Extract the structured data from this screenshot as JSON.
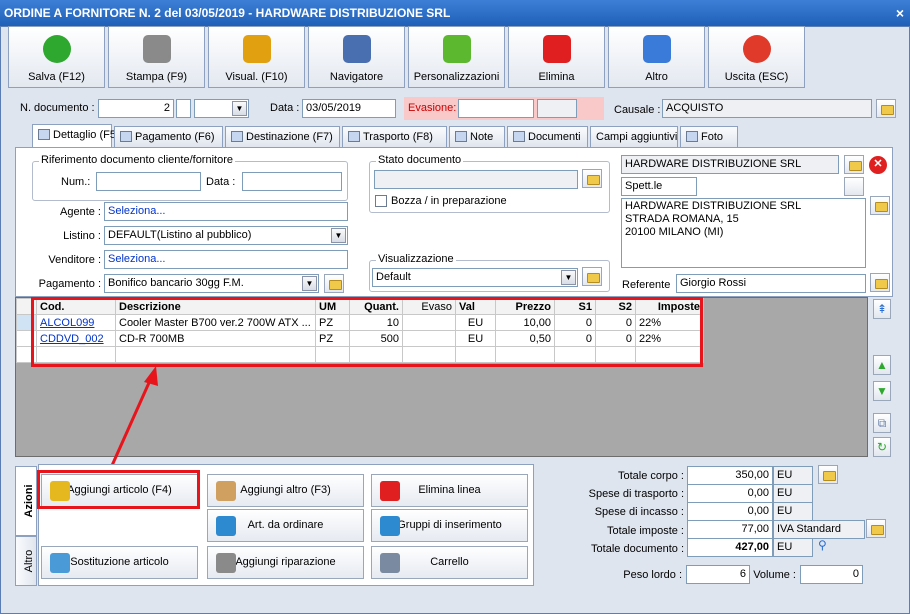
{
  "window": {
    "title": "ORDINE A FORNITORE N. 2 del 03/05/2019 - HARDWARE DISTRIBUZIONE SRL",
    "close": "×"
  },
  "toolbar": [
    {
      "label": "Salva (F12)",
      "icon": "check-icon",
      "color": "#2ea82e"
    },
    {
      "label": "Stampa (F9)",
      "icon": "printer-icon",
      "color": "#8a8a8a"
    },
    {
      "label": "Visual. (F10)",
      "icon": "magic-wand-icon",
      "color": "#e0a010"
    },
    {
      "label": "Navigatore",
      "icon": "compass-icon",
      "color": "#4a6fb0"
    },
    {
      "label": "Personalizzazioni",
      "icon": "puzzle-icon",
      "color": "#5cb82e"
    },
    {
      "label": "Elimina",
      "icon": "delete-x-icon",
      "color": "#e02020"
    },
    {
      "label": "Altro",
      "icon": "magnifier-icon",
      "color": "#3a7ad8"
    },
    {
      "label": "Uscita (ESC)",
      "icon": "power-icon",
      "color": "#e03a2a"
    }
  ],
  "header": {
    "ndoc_label": "N. documento :",
    "ndoc_value": "2",
    "data_label": "Data :",
    "data_value": "03/05/2019",
    "evasione_label": "Evasione:",
    "causale_label": "Causale :",
    "causale_value": "ACQUISTO"
  },
  "tabs": [
    {
      "label": "Dettaglio (F5)",
      "active": true
    },
    {
      "label": "Pagamento (F6)"
    },
    {
      "label": "Destinazione (F7)"
    },
    {
      "label": "Trasporto (F8)"
    },
    {
      "label": "Note"
    },
    {
      "label": "Documenti"
    },
    {
      "label": "Campi aggiuntivi"
    },
    {
      "label": "Foto"
    }
  ],
  "dettaglio": {
    "rif_title": "Riferimento documento cliente/fornitore",
    "num_label": "Num.:",
    "data_label": "Data :",
    "agente_label": "Agente :",
    "agente_value": "Seleziona...",
    "listino_label": "Listino :",
    "listino_value": "DEFAULT(Listino al pubblico)",
    "venditore_label": "Venditore :",
    "venditore_value": "Seleziona...",
    "pagamento_label": "Pagamento :",
    "pagamento_value": "Bonifico bancario 30gg F.M.",
    "stato_title": "Stato documento",
    "bozza_label": "Bozza / in preparazione",
    "visual_title": "Visualizzazione",
    "visual_value": "Default",
    "fornitore_name": "HARDWARE DISTRIBUZIONE SRL",
    "spett": "Spett.le",
    "address_lines": [
      "HARDWARE DISTRIBUZIONE SRL",
      "STRADA ROMANA, 15",
      "20100 MILANO (MI)"
    ],
    "referente_label": "Referente",
    "referente_value": "Giorgio Rossi"
  },
  "grid": {
    "columns": [
      "Cod.",
      "Descrizione",
      "UM",
      "Quant.",
      "Evaso",
      "Val",
      "Prezzo",
      "S1",
      "S2",
      "Imposte"
    ],
    "rows": [
      {
        "cod": "ALCOL099",
        "descr": "Cooler Master B700 ver.2 700W ATX ...",
        "um": "PZ",
        "quant": "10",
        "evaso": "",
        "val": "EU",
        "prezzo": "10,00",
        "s1": "0",
        "s2": "0",
        "imposte": "22%"
      },
      {
        "cod": "CDDVD_002",
        "descr": "CD-R 700MB",
        "um": "PZ",
        "quant": "500",
        "evaso": "",
        "val": "EU",
        "prezzo": "0,50",
        "s1": "0",
        "s2": "0",
        "imposte": "22%"
      }
    ]
  },
  "side_tabs": [
    "Azioni",
    "Altro"
  ],
  "actions": [
    {
      "label": "Aggiungi articolo (F4)",
      "icon": "add-article-icon"
    },
    {
      "label": "Aggiungi altro (F3)",
      "icon": "add-other-icon"
    },
    {
      "label": "Elimina linea",
      "icon": "delete-line-icon"
    },
    {
      "label": "Art. da ordinare",
      "icon": "order-article-icon"
    },
    {
      "label": "Gruppi di inserimento",
      "icon": "insert-group-icon"
    },
    {
      "label": "Sostituzione articolo",
      "icon": "replace-article-icon"
    },
    {
      "label": "Aggiungi riparazione",
      "icon": "repair-icon"
    },
    {
      "label": "Carrello",
      "icon": "cart-icon"
    }
  ],
  "totals": {
    "corpo_label": "Totale corpo :",
    "corpo_value": "350,00",
    "corpo_cur": "EU",
    "trasporto_label": "Spese di trasporto :",
    "trasporto_value": "0,00",
    "trasporto_cur": "EU",
    "incasso_label": "Spese di incasso :",
    "incasso_value": "0,00",
    "incasso_cur": "EU",
    "imposte_label": "Totale imposte :",
    "imposte_value": "77,00",
    "imposte_desc": "IVA Standard",
    "documento_label": "Totale documento :",
    "documento_value": "427,00",
    "documento_cur": "EU",
    "peso_label": "Peso lordo :",
    "peso_value": "6",
    "volume_label": "Volume :",
    "volume_value": "0"
  }
}
